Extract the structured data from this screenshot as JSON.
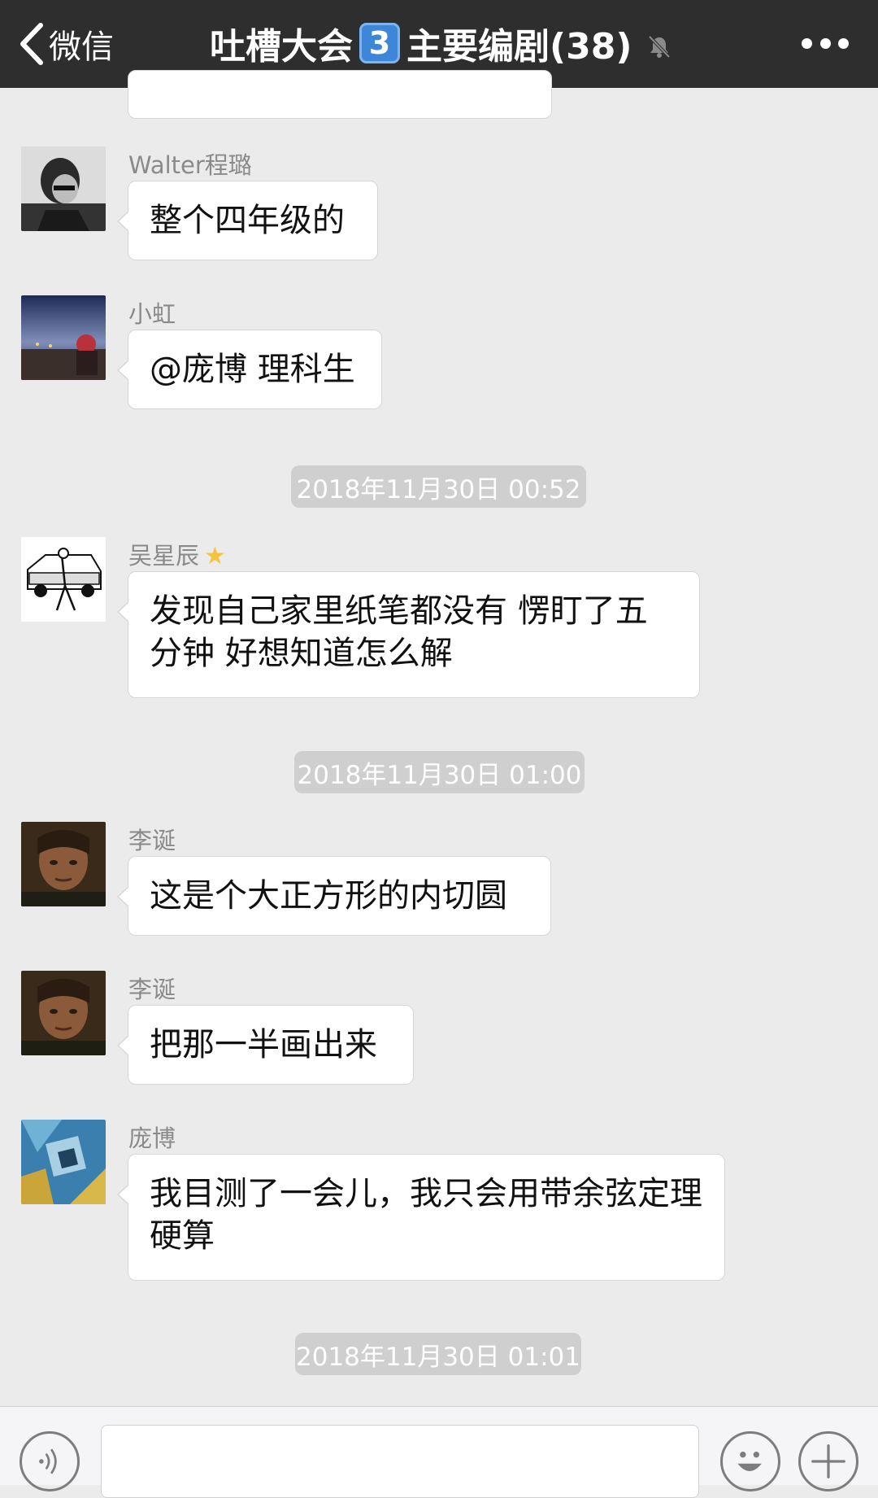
{
  "topbar": {
    "back_label": "微信",
    "title_prefix": "吐槽大会",
    "title_badge": "3",
    "title_suffix": "主要编剧(38)"
  },
  "messages": [
    {
      "name": "Walter程璐",
      "text": "整个四年级的"
    },
    {
      "name": "小虹",
      "text": "@庞博 理科生"
    },
    {
      "name": "吴星辰",
      "text": "发现自己家里纸笔都没有 愣盯了五分钟  好想知道怎么解",
      "badge_icon": "star-icon"
    },
    {
      "name": "李诞",
      "text": "这是个大正方形的内切圆"
    },
    {
      "name": "李诞",
      "text": "把那一半画出来"
    },
    {
      "name": "庞博",
      "text": "我目测了一会儿，我只会用带余弦定理硬算"
    }
  ],
  "timestamps": [
    "2018年11月30日 00:52",
    "2018年11月30日 01:00",
    "2018年11月30日 01:01"
  ],
  "inputbar": {
    "voice_icon": "voice-icon",
    "emoji_icon": "emoji-icon",
    "add_icon": "plus-icon",
    "input_value": ""
  },
  "colors": {
    "topbar_bg": "#2e2e2e",
    "chat_bg": "#ebebeb",
    "timestamp_bg": "#cfcfcf",
    "title_badge_bg": "#3d86d8"
  }
}
